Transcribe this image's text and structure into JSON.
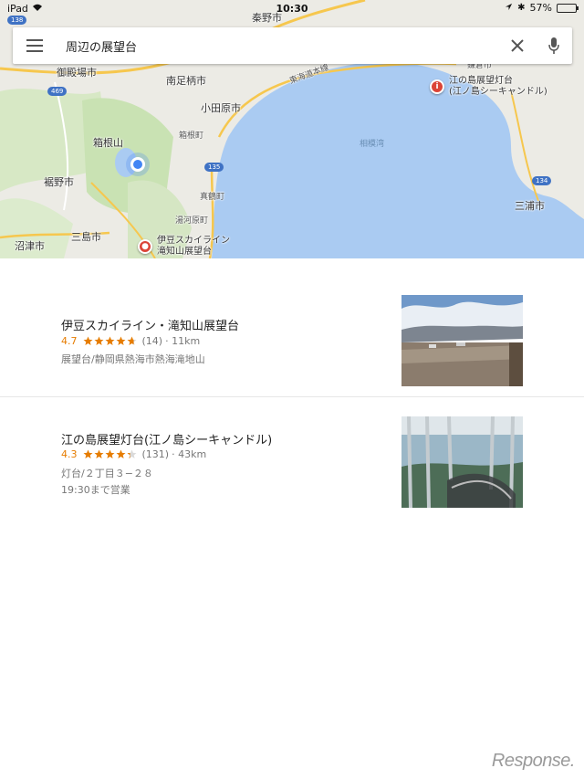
{
  "status_bar": {
    "device": "iPad",
    "time": "10:30",
    "battery": "57%",
    "battery_level": 0.57
  },
  "search": {
    "query": "周辺の展望台"
  },
  "map": {
    "labels": {
      "hadano": "秦野市",
      "gotemba": "御殿場市",
      "minamiashigara": "南足柄市",
      "odawara": "小田原市",
      "hakoneyama": "箱根山",
      "hakone": "箱根町",
      "susono": "裾野市",
      "manazuru": "真鶴町",
      "yugawara": "湯河原町",
      "mishima": "三島市",
      "numazu": "沼津市",
      "sagamiwan": "相模湾",
      "miura": "三浦市",
      "tokaido": "東海道本線",
      "kamakura": "鎌倉市",
      "izu_pin": "伊豆スカイライン\n滝知山展望台",
      "enoshima_pin": "江の島展望灯台\n(江ノ島シーキャンドル)"
    },
    "shields": [
      "138",
      "469",
      "135",
      "134"
    ],
    "colors": {
      "land": "#ecebe5",
      "sea": "#aacbf2",
      "green": "#c9e2b3",
      "road": "#f6c74e",
      "pin": "#db4437",
      "location": "#4285f4"
    }
  },
  "results": [
    {
      "title": "伊豆スカイライン・滝知山展望台",
      "rating": "4.7",
      "stars": 4.7,
      "reviews": "(14)",
      "distance": "· 11km",
      "detail": "展望台/静岡県熱海市熱海滝地山",
      "hours": ""
    },
    {
      "title": "江の島展望灯台(江ノ島シーキャンドル)",
      "rating": "4.3",
      "stars": 4.3,
      "reviews": "(131)",
      "distance": "· 43km",
      "detail": "灯台/２丁目３−２８",
      "hours": "19:30まで営業"
    }
  ],
  "watermark": "Response."
}
